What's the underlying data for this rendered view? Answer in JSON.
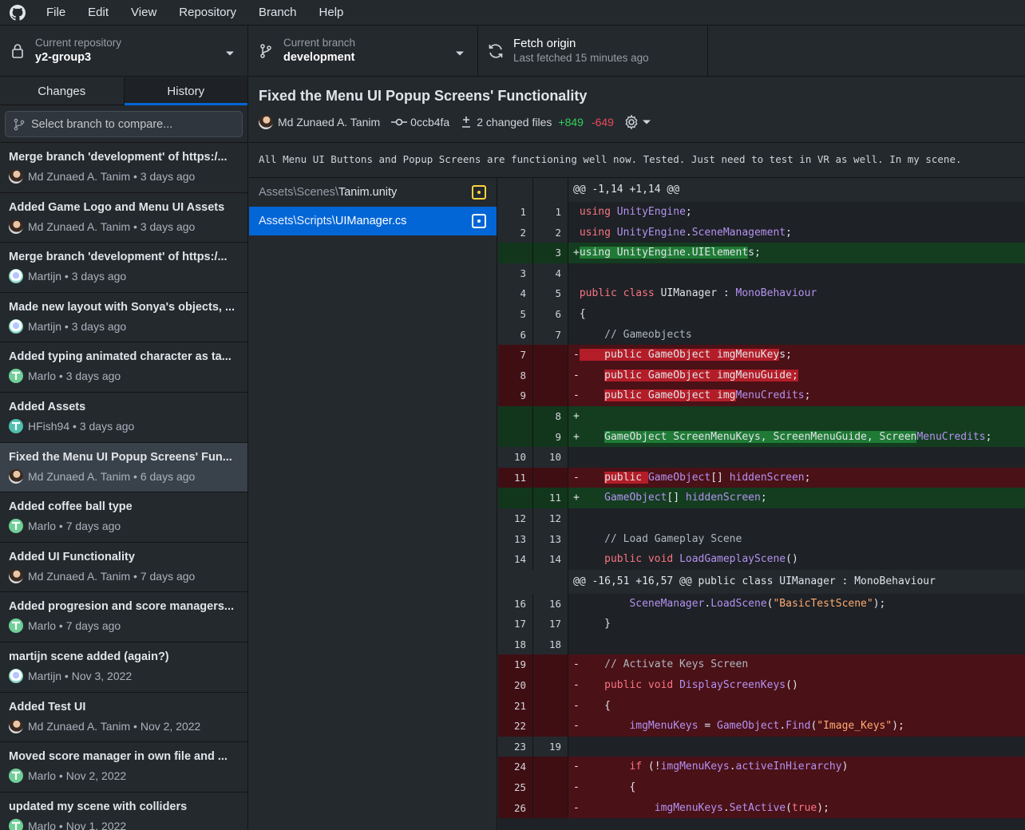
{
  "menu": [
    "File",
    "Edit",
    "View",
    "Repository",
    "Branch",
    "Help"
  ],
  "toolbar": {
    "repo_label": "Current repository",
    "repo_value": "y2-group3",
    "branch_label": "Current branch",
    "branch_value": "development",
    "fetch_label": "Fetch origin",
    "fetch_sub": "Last fetched 15 minutes ago"
  },
  "tabs": {
    "changes": "Changes",
    "history": "History"
  },
  "compare_placeholder": "Select branch to compare...",
  "commits": [
    {
      "title": "Merge branch 'development' of https:/...",
      "author": "Md Zunaed A. Tanim",
      "date": "3 days ago",
      "avatar": "md"
    },
    {
      "title": "Added Game Logo and Menu UI Assets",
      "author": "Md Zunaed A. Tanim",
      "date": "3 days ago",
      "avatar": "md"
    },
    {
      "title": "Merge branch 'development' of https:/...",
      "author": "Martijn",
      "date": "3 days ago",
      "avatar": "mart"
    },
    {
      "title": "Made new layout with Sonya's objects, ...",
      "author": "Martijn",
      "date": "3 days ago",
      "avatar": "mart"
    },
    {
      "title": "Added typing animated character as ta...",
      "author": "Marlo",
      "date": "3 days ago",
      "avatar": "marlo"
    },
    {
      "title": "Added Assets",
      "author": "HFish94",
      "date": "3 days ago",
      "avatar": "hfish"
    },
    {
      "title": "Fixed the Menu UI Popup Screens' Fun...",
      "author": "Md Zunaed A. Tanim",
      "date": "6 days ago",
      "avatar": "md"
    },
    {
      "title": "Added coffee ball type",
      "author": "Marlo",
      "date": "7 days ago",
      "avatar": "marlo"
    },
    {
      "title": "Added UI Functionality",
      "author": "Md Zunaed A. Tanim",
      "date": "7 days ago",
      "avatar": "md"
    },
    {
      "title": "Added progresion and score managers...",
      "author": "Marlo",
      "date": "7 days ago",
      "avatar": "marlo"
    },
    {
      "title": "martijn scene added (again?)",
      "author": "Martijn",
      "date": "Nov 3, 2022",
      "avatar": "mart"
    },
    {
      "title": "Added Test UI",
      "author": "Md Zunaed A. Tanim",
      "date": "Nov 2, 2022",
      "avatar": "md"
    },
    {
      "title": "Moved score manager in own file and ...",
      "author": "Marlo",
      "date": "Nov 2, 2022",
      "avatar": "marlo"
    },
    {
      "title": "updated my scene with colliders",
      "author": "Marlo",
      "date": "Nov 1, 2022",
      "avatar": "marlo"
    }
  ],
  "selected_commit": {
    "title": "Fixed the Menu UI Popup Screens' Functionality",
    "author": "Md Zunaed A. Tanim",
    "sha": "0ccb4fa",
    "changed_files": "2 changed files",
    "additions": "+849",
    "deletions": "-649",
    "description": "All Menu UI Buttons and Popup Screens are functioning well now. Tested. Just need to test in VR as well. In my scene."
  },
  "files": [
    {
      "dir": "Assets\\Scenes\\",
      "name": "Tanim.unity"
    },
    {
      "dir": "Assets\\Scripts\\",
      "name": "UIManager.cs"
    }
  ],
  "diff": {
    "hunk1": "@@ -1,14 +1,14 @@",
    "hunk2": "@@ -16,51 +16,57 @@ public class UIManager : MonoBehaviour",
    "colors": {
      "add": "#143d20",
      "del": "#4a1117",
      "accent": "#0366d6"
    }
  }
}
